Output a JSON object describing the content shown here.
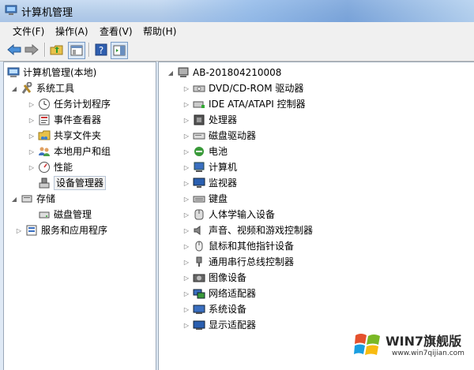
{
  "window": {
    "title": "计算机管理"
  },
  "menu": [
    "文件(F)",
    "操作(A)",
    "查看(V)",
    "帮助(H)"
  ],
  "toolbar": {
    "buttons": [
      "back-icon",
      "forward-icon",
      "up-folder-icon",
      "show-hide-tree-icon",
      "help-icon",
      "action-pane-icon"
    ]
  },
  "tree": {
    "root": "计算机管理(本地)",
    "system_tools": "系统工具",
    "items": [
      "任务计划程序",
      "事件查看器",
      "共享文件夹",
      "本地用户和组",
      "性能",
      "设备管理器"
    ],
    "storage": "存储",
    "disk_mgmt": "磁盘管理",
    "services": "服务和应用程序"
  },
  "devices": {
    "computer": "AB-201804210008",
    "categories": [
      "DVD/CD-ROM 驱动器",
      "IDE ATA/ATAPI 控制器",
      "处理器",
      "磁盘驱动器",
      "电池",
      "计算机",
      "监视器",
      "键盘",
      "人体学输入设备",
      "声音、视频和游戏控制器",
      "鼠标和其他指针设备",
      "通用串行总线控制器",
      "图像设备",
      "网络适配器",
      "系统设备",
      "显示适配器"
    ]
  },
  "watermark": {
    "text": "WIN7旗舰版",
    "url": "www.win7qijian.com"
  }
}
